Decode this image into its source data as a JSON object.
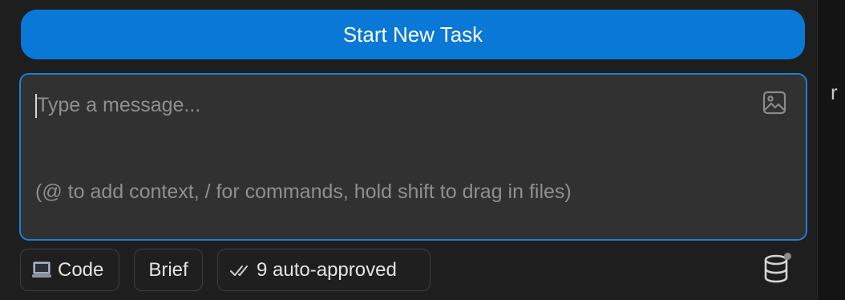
{
  "start_button": {
    "label": "Start New Task"
  },
  "message_input": {
    "placeholder": "Type a message...",
    "hint": "(@ to add context, / for commands, hold shift to drag in files)"
  },
  "toolbar": {
    "mode_label": "Code",
    "brief_label": "Brief",
    "auto_approved_label": "9 auto-approved"
  },
  "right_edge": {
    "letter": "r"
  },
  "icons": {
    "image_icon": "image-icon",
    "laptop_icon": "laptop-icon",
    "double_check_icon": "double-check-icon",
    "database_icon": "database-icon"
  },
  "colors": {
    "accent": "#0a78d7",
    "input_border": "#1f7fd6",
    "background": "#1e1e1e",
    "input_background": "#313131"
  }
}
